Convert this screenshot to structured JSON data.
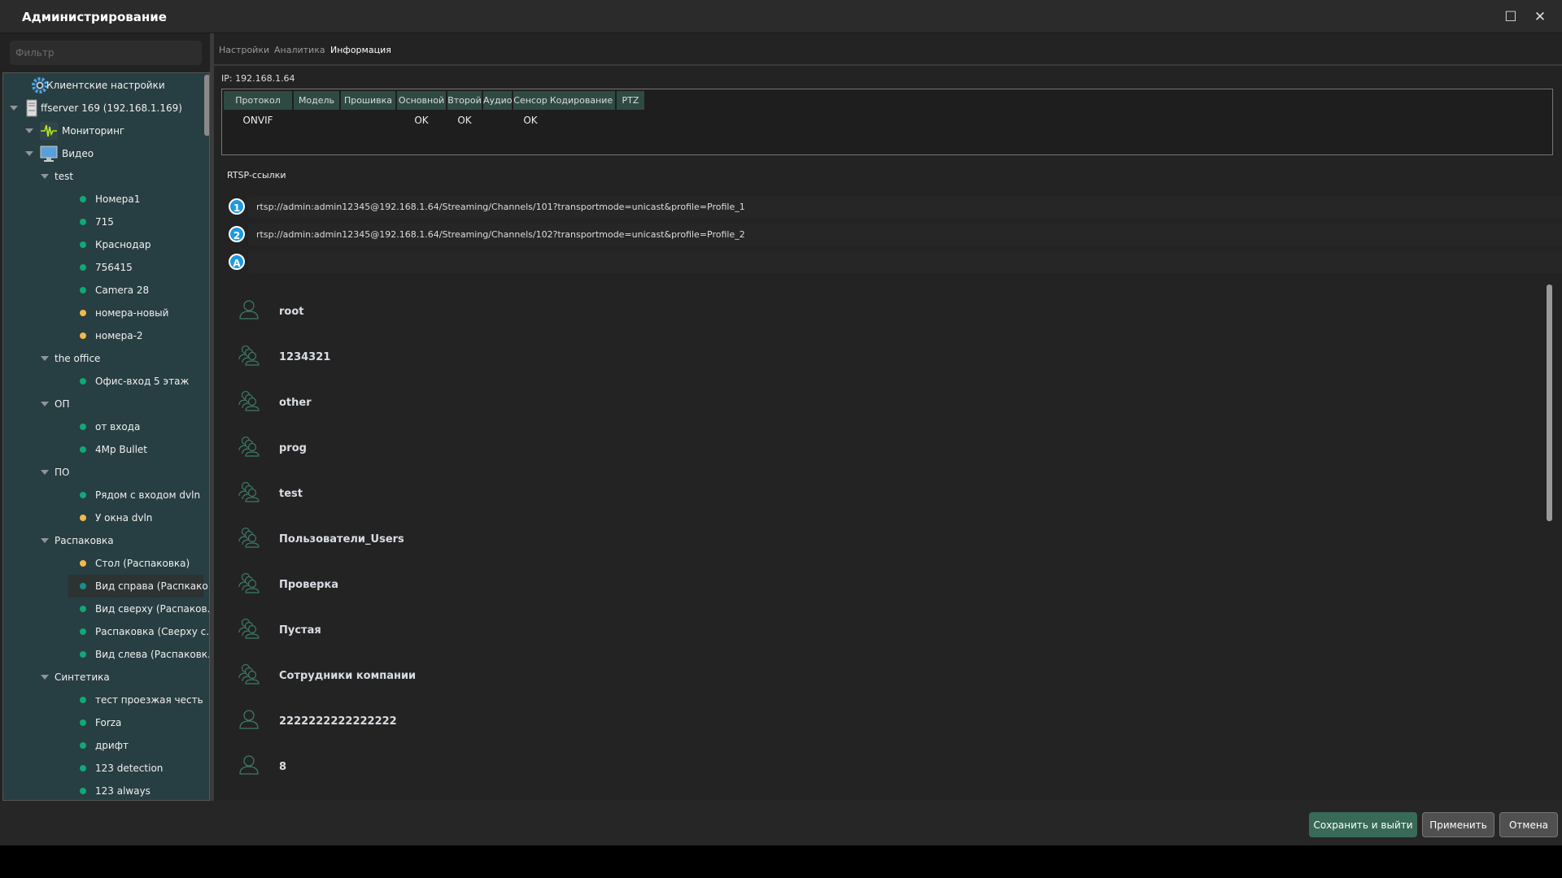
{
  "window": {
    "title": "Администрирование",
    "maximize_icon": "maximize-icon",
    "close_icon": "close-icon"
  },
  "sidebar": {
    "filter_placeholder": "Фильтр",
    "tree": [
      {
        "label": "Клиентские настройки",
        "level": 0,
        "icon": "gear-icon"
      },
      {
        "label": "ffserver 169 (192.168.1.169)",
        "level": 1,
        "icon": "server-icon",
        "expanded": true
      },
      {
        "label": "Мониторинг",
        "level": 2,
        "icon": "monitoring-icon"
      },
      {
        "label": "Видео",
        "level": 2,
        "icon": "monitor-icon",
        "expanded": true
      },
      {
        "label": "test",
        "level": 3,
        "expanded": true
      },
      {
        "label": "Номера1",
        "level": 4,
        "status": "green"
      },
      {
        "label": "715",
        "level": 4,
        "status": "green"
      },
      {
        "label": "Краснодар",
        "level": 4,
        "status": "green"
      },
      {
        "label": "756415",
        "level": 4,
        "status": "green"
      },
      {
        "label": "Camera 28",
        "level": 4,
        "status": "green"
      },
      {
        "label": "номера-новый",
        "level": 4,
        "status": "yellow"
      },
      {
        "label": "номера-2",
        "level": 4,
        "status": "yellow"
      },
      {
        "label": "the office",
        "level": 3,
        "expanded": true
      },
      {
        "label": "Офис-вход 5 этаж",
        "level": 4,
        "status": "green"
      },
      {
        "label": "ОП",
        "level": 3,
        "expanded": true
      },
      {
        "label": "от входа",
        "level": 4,
        "status": "green"
      },
      {
        "label": "4Mp Bullet",
        "level": 4,
        "status": "green"
      },
      {
        "label": "ПО",
        "level": 3,
        "expanded": true
      },
      {
        "label": "Рядом с входом dvln",
        "level": 4,
        "status": "green"
      },
      {
        "label": "У окна dvln",
        "level": 4,
        "status": "yellow"
      },
      {
        "label": "Распаковка",
        "level": 3,
        "expanded": true
      },
      {
        "label": "Стол (Распаковка)",
        "level": 4,
        "status": "yellow"
      },
      {
        "label": "Вид справа (Распкако...",
        "level": 4,
        "status": "teal",
        "selected": true
      },
      {
        "label": "Вид сверху (Распаков...",
        "level": 4,
        "status": "green"
      },
      {
        "label": "Распаковка (Сверху с...",
        "level": 4,
        "status": "green"
      },
      {
        "label": "Вид слева (Распаковк...",
        "level": 4,
        "status": "green"
      },
      {
        "label": "Синтетика",
        "level": 3,
        "expanded": true
      },
      {
        "label": "тест проезжая честь",
        "level": 4,
        "status": "green"
      },
      {
        "label": "Forza",
        "level": 4,
        "status": "green"
      },
      {
        "label": "дрифт",
        "level": 4,
        "status": "green"
      },
      {
        "label": "123 detection",
        "level": 4,
        "status": "green"
      },
      {
        "label": "123 always",
        "level": 4,
        "status": "green"
      }
    ]
  },
  "tabs": [
    {
      "label": "Настройки"
    },
    {
      "label": "Аналитика"
    },
    {
      "label": "Информация",
      "active": true
    }
  ],
  "info": {
    "ip": "IP: 192.168.1.64",
    "table": {
      "headers": [
        "Протокол",
        "Модель",
        "Прошивка",
        "Основной",
        "Второй",
        "Аудио",
        "Сенсор",
        "Кодирование",
        "PTZ"
      ],
      "rows": [
        [
          "ONVIF",
          "",
          "",
          "OK",
          "OK",
          "",
          "OK",
          "",
          ""
        ]
      ]
    },
    "rtsp_label": "RTSP-ссылки",
    "rtsp": [
      {
        "badge": "1",
        "url": "rtsp://admin:admin12345@192.168.1.64/Streaming/Channels/101?transportmode=unicast&profile=Profile_1"
      },
      {
        "badge": "2",
        "url": "rtsp://admin:admin12345@192.168.1.64/Streaming/Channels/102?transportmode=unicast&profile=Profile_2"
      },
      {
        "badge": "A",
        "url": ""
      }
    ],
    "users": [
      {
        "name": "root",
        "type": "user"
      },
      {
        "name": "1234321",
        "type": "group"
      },
      {
        "name": "other",
        "type": "group"
      },
      {
        "name": "prog",
        "type": "group"
      },
      {
        "name": "test",
        "type": "group"
      },
      {
        "name": "Пользователи_Users",
        "type": "group"
      },
      {
        "name": "Проверка",
        "type": "group"
      },
      {
        "name": "Пустая",
        "type": "group"
      },
      {
        "name": "Сотрудники компании",
        "type": "group"
      },
      {
        "name": "2222222222222222",
        "type": "user"
      },
      {
        "name": "8",
        "type": "user"
      }
    ]
  },
  "footer": {
    "save_label": "Сохранить и выйти",
    "apply_label": "Применить",
    "cancel_label": "Отмена"
  },
  "colors": {
    "green": "#10a878",
    "yellow": "#f2b84b",
    "teal": "#13908c",
    "accent": "#386a57"
  }
}
